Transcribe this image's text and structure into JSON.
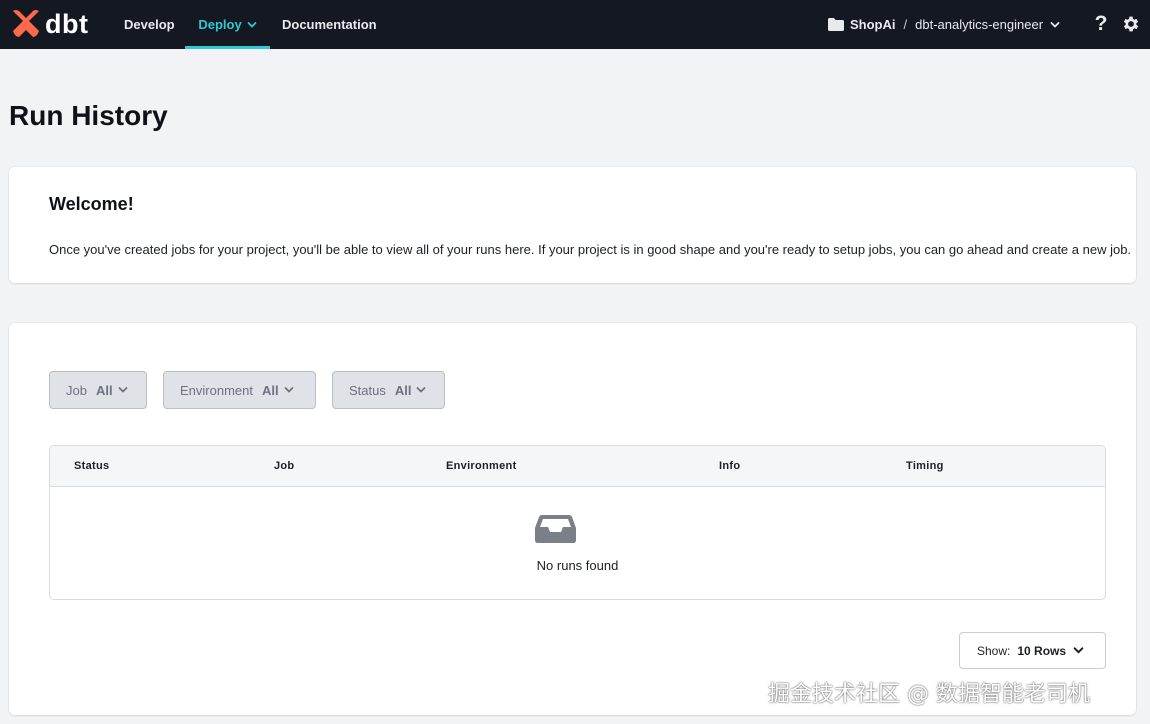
{
  "nav": {
    "logo_text": "dbt",
    "items": [
      {
        "label": "Develop"
      },
      {
        "label": "Deploy",
        "active": true
      },
      {
        "label": "Documentation"
      }
    ],
    "account": "ShopAi",
    "separator": "/",
    "project": "dbt-analytics-engineer",
    "help_label": "?"
  },
  "page": {
    "title": "Run History"
  },
  "welcome": {
    "heading": "Welcome!",
    "text": "Once you've created jobs for your project, you'll be able to view all of your runs here. If your project is in good shape and you're ready to setup jobs, you can go ahead and create a new job."
  },
  "filters": {
    "job": {
      "label": "Job",
      "value": "All"
    },
    "environment": {
      "label": "Environment",
      "value": "All"
    },
    "status": {
      "label": "Status",
      "value": "All"
    }
  },
  "table": {
    "columns": [
      "Status",
      "Job",
      "Environment",
      "Info",
      "Timing"
    ],
    "empty_text": "No runs found",
    "empty_icon": "inbox-icon"
  },
  "pagination": {
    "show_label": "Show:",
    "rows_value": "10 Rows"
  },
  "watermark": "掘金技术社区 @ 数据智能老司机",
  "colors": {
    "nav_bg": "#141821",
    "accent": "#2fc8d4",
    "brand_orange": "#ff694b",
    "page_bg": "#f2f3f5"
  }
}
